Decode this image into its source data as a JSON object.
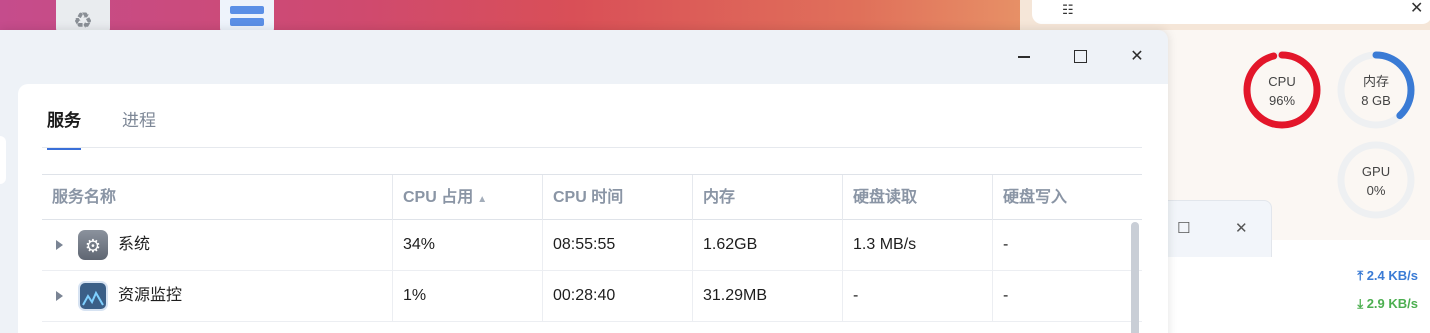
{
  "widgets": {
    "cpu": {
      "label": "CPU",
      "value": "96%",
      "percent": 96,
      "color": "#e3162a"
    },
    "memory": {
      "label": "内存",
      "value": "8 GB",
      "percent": 38,
      "color": "#3a7bd5"
    },
    "gpu": {
      "label": "GPU",
      "value": "0%",
      "percent": 0,
      "color": "#3a7bd5"
    },
    "network": {
      "upload": "2.4 KB/s",
      "download": "2.9 KB/s",
      "upload_color": "#3a7bd5",
      "download_color": "#4caf50"
    }
  },
  "main_window": {
    "tabs": [
      {
        "label": "服务",
        "active": true
      },
      {
        "label": "进程",
        "active": false
      }
    ],
    "columns": [
      "服务名称",
      "CPU 占用",
      "CPU 时间",
      "内存",
      "硬盘读取",
      "硬盘写入"
    ],
    "rows": [
      {
        "name": "系统",
        "icon": "gear-icon",
        "cpu": "34%",
        "cpu_time": "08:55:55",
        "memory": "1.62GB",
        "disk_read": "1.3 MB/s",
        "disk_write": "-"
      },
      {
        "name": "资源监控",
        "icon": "monitor-icon",
        "cpu": "1%",
        "cpu_time": "00:28:40",
        "memory": "31.29MB",
        "disk_read": "-",
        "disk_write": "-"
      }
    ]
  },
  "colors": {
    "accent": "#3a6fd8"
  }
}
